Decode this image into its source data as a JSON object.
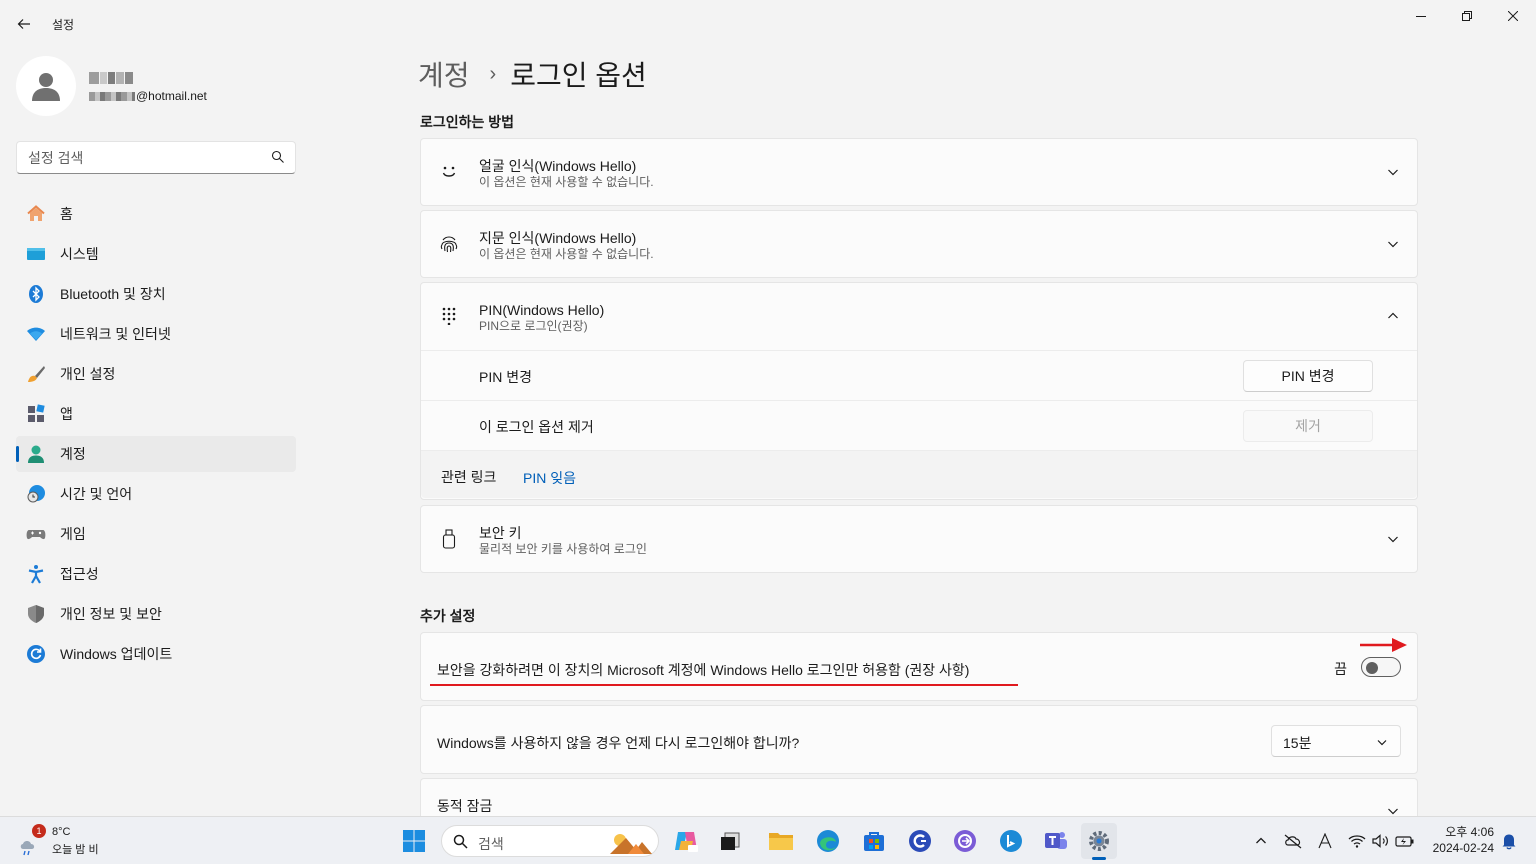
{
  "window": {
    "title": "설정",
    "controls": [
      "minimize",
      "restore",
      "close"
    ]
  },
  "profile": {
    "email_suffix": "@hotmail.net"
  },
  "search": {
    "placeholder": "설정 검색"
  },
  "nav": {
    "items": [
      {
        "label": "홈",
        "icon": "home-icon",
        "active": false
      },
      {
        "label": "시스템",
        "icon": "system-icon",
        "active": false
      },
      {
        "label": "Bluetooth 및 장치",
        "icon": "bluetooth-icon",
        "active": false
      },
      {
        "label": "네트워크 및 인터넷",
        "icon": "wifi-icon",
        "active": false
      },
      {
        "label": "개인 설정",
        "icon": "brush-icon",
        "active": false
      },
      {
        "label": "앱",
        "icon": "apps-icon",
        "active": false
      },
      {
        "label": "계정",
        "icon": "account-icon",
        "active": true
      },
      {
        "label": "시간 및 언어",
        "icon": "time-language-icon",
        "active": false
      },
      {
        "label": "게임",
        "icon": "gamepad-icon",
        "active": false
      },
      {
        "label": "접근성",
        "icon": "accessibility-icon",
        "active": false
      },
      {
        "label": "개인 정보 및 보안",
        "icon": "shield-icon",
        "active": false
      },
      {
        "label": "Windows 업데이트",
        "icon": "update-icon",
        "active": false
      }
    ]
  },
  "breadcrumb": {
    "parent": "계정",
    "separator": "›",
    "current": "로그인 옵션"
  },
  "signin_methods": {
    "title": "로그인하는 방법",
    "face": {
      "title": "얼굴 인식(Windows Hello)",
      "subtitle": "이 옵션은 현재 사용할 수 없습니다."
    },
    "fingerprint": {
      "title": "지문 인식(Windows Hello)",
      "subtitle": "이 옵션은 현재 사용할 수 없습니다."
    },
    "pin": {
      "title": "PIN(Windows Hello)",
      "subtitle": "PIN으로 로그인(권장)",
      "change_label": "PIN 변경",
      "change_button": "PIN 변경",
      "remove_label": "이 로그인 옵션 제거",
      "remove_button": "제거",
      "related_label": "관련 링크",
      "related_link": "PIN 잊음"
    },
    "security_key": {
      "title": "보안 키",
      "subtitle": "물리적 보안 키를 사용하여 로그인"
    }
  },
  "additional": {
    "title": "추가 설정",
    "hello_only": {
      "label": "보안을 강화하려면 이 장치의 Microsoft 계정에 Windows Hello 로그인만 허용함 (권장 사항)",
      "state": "끔",
      "on": false
    },
    "away": {
      "label": "Windows를 사용하지 않을 경우 언제 다시 로그인해야 합니까?",
      "value": "15분"
    },
    "dynamic_lock": {
      "label": "동적 잠금"
    }
  },
  "taskbar": {
    "weather_temp": "8°C",
    "weather_desc": "오늘 밤 비",
    "weather_badge": "1",
    "search_label": "검색",
    "time": "오후 4:06",
    "date": "2024-02-24"
  },
  "colors": {
    "accent": "#005fb8",
    "annotation_red": "#e0191e"
  }
}
